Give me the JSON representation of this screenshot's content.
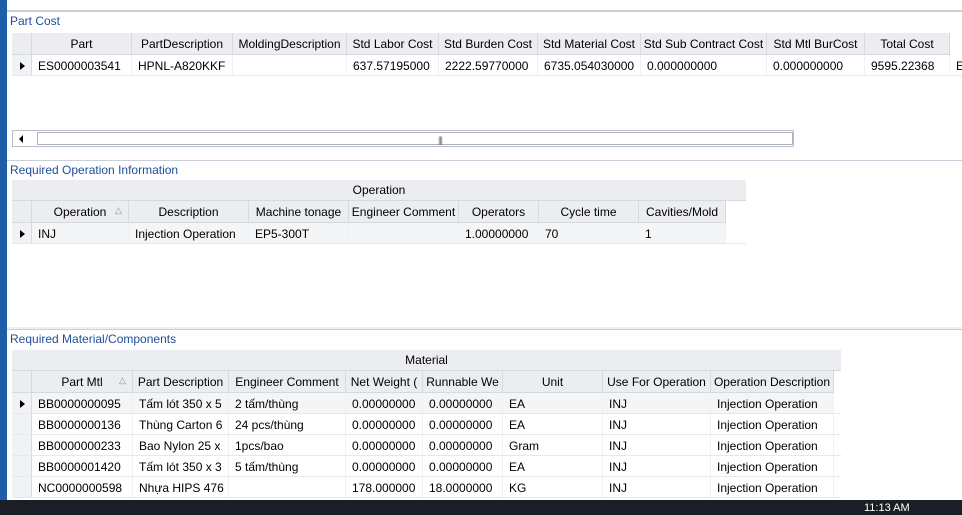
{
  "part_cost": {
    "title": "Part Cost",
    "columns": [
      "Part",
      "PartDescription",
      "MoldingDescription",
      "Std Labor Cost",
      "Std Burden Cost",
      "Std Material Cost",
      "Std Sub Contract Cost",
      "Std Mtl BurCost",
      "Total Cost"
    ],
    "rows": [
      [
        "ES0000003541",
        "HPNL-A820KKF",
        "",
        "637.57195000",
        "2222.59770000",
        "6735.054030000",
        "0.000000000",
        "0.000000000",
        "9595.22368",
        "E/"
      ]
    ]
  },
  "operation": {
    "title": "Required Operation Information",
    "group_header": "Operation",
    "columns": [
      "Operation",
      "Description",
      "Machine tonage",
      "Engineer Comment",
      "Operators",
      "Cycle time",
      "Cavities/Mold"
    ],
    "rows": [
      [
        "INJ",
        "Injection Operation",
        "EP5-300T",
        "",
        "1.00000000",
        "70",
        "1"
      ]
    ]
  },
  "material": {
    "title": "Required Material/Components",
    "group_header": "Material",
    "columns": [
      "Part Mtl",
      "Part Description",
      "Engineer Comment",
      "Net Weight (",
      "Runnable We",
      "Unit",
      "Use For Operation",
      "Operation Description"
    ],
    "rows": [
      [
        "BB0000000095",
        "Tấm lót 350 x 5",
        "2 tấm/thùng",
        "0.00000000",
        "0.00000000",
        "EA",
        "INJ",
        "Injection Operation"
      ],
      [
        "BB0000000136",
        "Thùng Carton  6",
        "24 pcs/thùng",
        "0.00000000",
        "0.00000000",
        "EA",
        "INJ",
        "Injection Operation"
      ],
      [
        "BB0000000233",
        "Bao Nylon 25 x",
        "1pcs/bao",
        "0.00000000",
        "0.00000000",
        "Gram",
        "INJ",
        "Injection Operation"
      ],
      [
        "BB0000001420",
        "Tấm lót 350 x 3",
        "5 tấm/thùng",
        "0.00000000",
        "0.00000000",
        "EA",
        "INJ",
        "Injection Operation"
      ],
      [
        "NC0000000598",
        "Nhựa HIPS 476",
        "",
        "178.000000",
        "18.0000000",
        "KG",
        "INJ",
        "Injection Operation"
      ]
    ]
  },
  "taskbar": {
    "clock": "11:13 AM"
  }
}
